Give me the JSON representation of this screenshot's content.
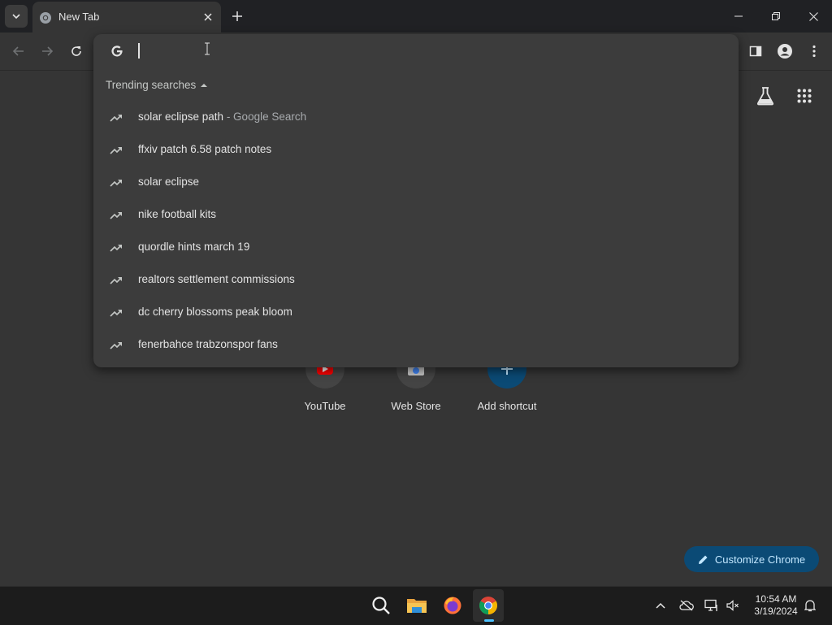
{
  "tab": {
    "title": "New Tab"
  },
  "omnibox": {
    "value": "",
    "placeholder": ""
  },
  "trending": {
    "header": "Trending searches",
    "items": [
      {
        "text": "solar eclipse path",
        "suffix": " - Google Search"
      },
      {
        "text": "ffxiv patch 6.58 patch notes",
        "suffix": ""
      },
      {
        "text": "solar eclipse",
        "suffix": ""
      },
      {
        "text": "nike football kits",
        "suffix": ""
      },
      {
        "text": "quordle hints march 19",
        "suffix": ""
      },
      {
        "text": "realtors settlement commissions",
        "suffix": ""
      },
      {
        "text": "dc cherry blossoms peak bloom",
        "suffix": ""
      },
      {
        "text": "fenerbahce trabzonspor fans",
        "suffix": ""
      }
    ]
  },
  "shortcuts": [
    {
      "label": "YouTube"
    },
    {
      "label": "Web Store"
    },
    {
      "label": "Add shortcut"
    }
  ],
  "customize": {
    "label": "Customize Chrome"
  },
  "taskbar": {
    "apps": [
      "search-icon",
      "file-explorer-icon",
      "firefox-icon",
      "chrome-icon"
    ],
    "clock": {
      "time": "10:54 AM",
      "date": "3/19/2024"
    }
  },
  "colors": {
    "accent": "#0b4a75",
    "taskbar_active": "#4cc2ff"
  }
}
